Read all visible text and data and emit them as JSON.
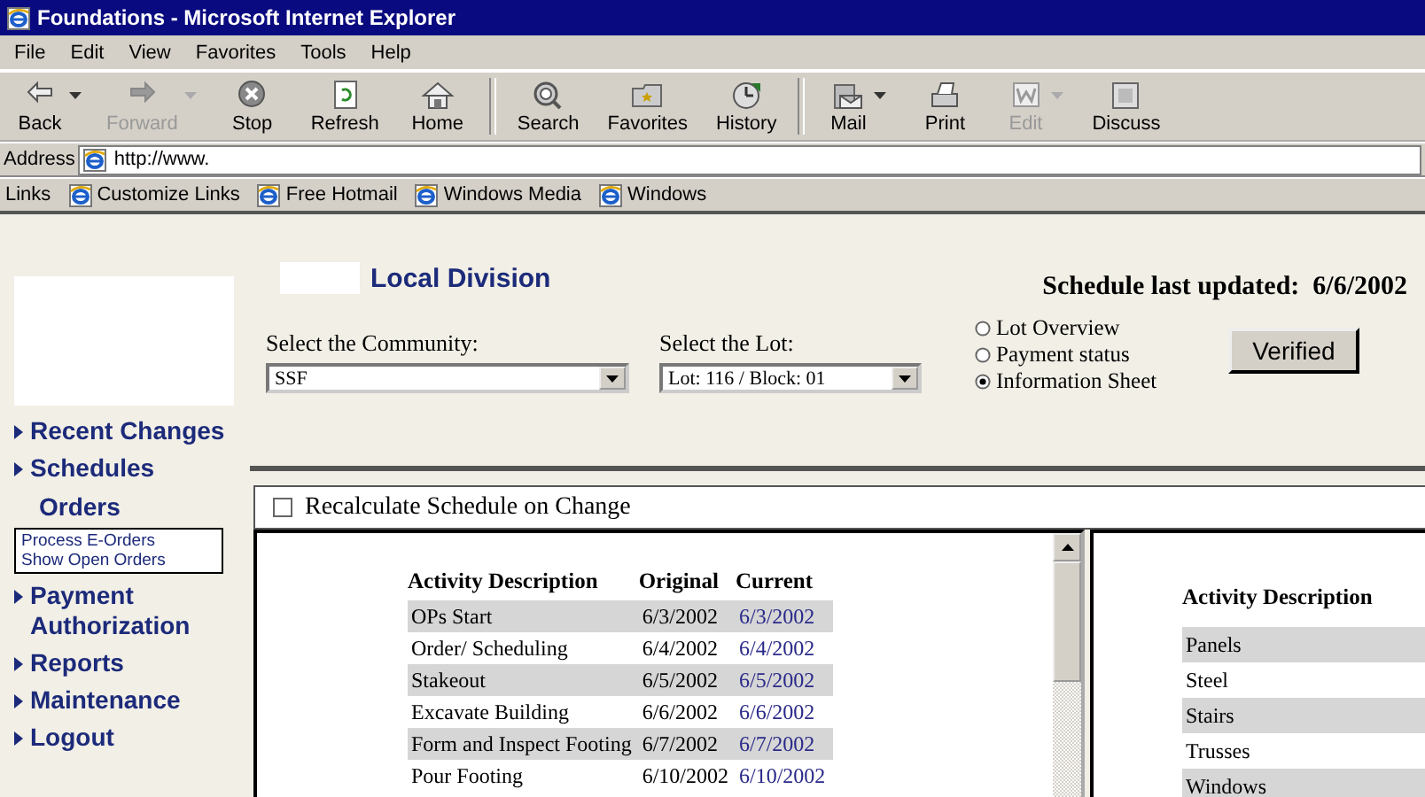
{
  "window": {
    "title": "Foundations - Microsoft Internet Explorer"
  },
  "menu": [
    "File",
    "Edit",
    "View",
    "Favorites",
    "Tools",
    "Help"
  ],
  "toolbar": [
    {
      "label": "Back",
      "kind": "back",
      "dropdown": true,
      "disabled": false
    },
    {
      "label": "Forward",
      "kind": "forward",
      "dropdown": true,
      "disabled": true
    },
    {
      "label": "Stop",
      "kind": "stop",
      "dropdown": false,
      "disabled": false
    },
    {
      "label": "Refresh",
      "kind": "refresh",
      "dropdown": false,
      "disabled": false
    },
    {
      "label": "Home",
      "kind": "home",
      "dropdown": false,
      "disabled": false
    },
    {
      "label": "Search",
      "kind": "search",
      "dropdown": false,
      "disabled": false
    },
    {
      "label": "Favorites",
      "kind": "favorites",
      "dropdown": false,
      "disabled": false
    },
    {
      "label": "History",
      "kind": "history",
      "dropdown": false,
      "disabled": false
    },
    {
      "label": "Mail",
      "kind": "mail",
      "dropdown": true,
      "disabled": false
    },
    {
      "label": "Print",
      "kind": "print",
      "dropdown": false,
      "disabled": false
    },
    {
      "label": "Edit",
      "kind": "edit",
      "dropdown": true,
      "disabled": true
    },
    {
      "label": "Discuss",
      "kind": "discuss",
      "dropdown": false,
      "disabled": false
    }
  ],
  "address": {
    "label": "Address",
    "value": "http://www."
  },
  "links": {
    "label": "Links",
    "items": [
      "Customize Links",
      "Free Hotmail",
      "Windows Media",
      "Windows"
    ]
  },
  "sidebar": {
    "items": [
      {
        "kind": "link",
        "label": "Recent Changes"
      },
      {
        "kind": "link",
        "label": "Schedules"
      },
      {
        "kind": "heading",
        "label": "Orders"
      },
      {
        "kind": "box",
        "items": [
          "Process E-Orders",
          "Show Open Orders"
        ]
      },
      {
        "kind": "link",
        "label": "Payment Authorization"
      },
      {
        "kind": "link",
        "label": "Reports"
      },
      {
        "kind": "link",
        "label": "Maintenance"
      },
      {
        "kind": "link",
        "label": "Logout"
      }
    ]
  },
  "header": {
    "division": "Local Division",
    "updated_label": "Schedule last updated:",
    "updated_date": "6/6/2002"
  },
  "community": {
    "label": "Select the Community:",
    "value": "SSF"
  },
  "lot": {
    "label": "Select the Lot:",
    "value": "Lot: 116 / Block: 01"
  },
  "views": [
    {
      "label": "Lot Overview",
      "selected": false
    },
    {
      "label": "Payment status",
      "selected": false
    },
    {
      "label": "Information Sheet",
      "selected": true
    }
  ],
  "verify_button": "Verified",
  "recalculate": {
    "label": "Recalculate Schedule on Change",
    "checked": false
  },
  "schedule_table": {
    "columns": [
      "Activity Description",
      "Original",
      "Current"
    ],
    "rows": [
      [
        "OPs Start",
        "6/3/2002",
        "6/3/2002"
      ],
      [
        "Order/ Scheduling",
        "6/4/2002",
        "6/4/2002"
      ],
      [
        "Stakeout",
        "6/5/2002",
        "6/5/2002"
      ],
      [
        "Excavate Building",
        "6/6/2002",
        "6/6/2002"
      ],
      [
        "Form and Inspect Footing",
        "6/7/2002",
        "6/7/2002"
      ],
      [
        "Pour Footing",
        "6/10/2002",
        "6/10/2002"
      ]
    ]
  },
  "materials_table": {
    "columns": [
      "Activity Description"
    ],
    "rows": [
      "Panels",
      "Steel",
      "Stairs",
      "Trusses",
      "Windows"
    ]
  }
}
